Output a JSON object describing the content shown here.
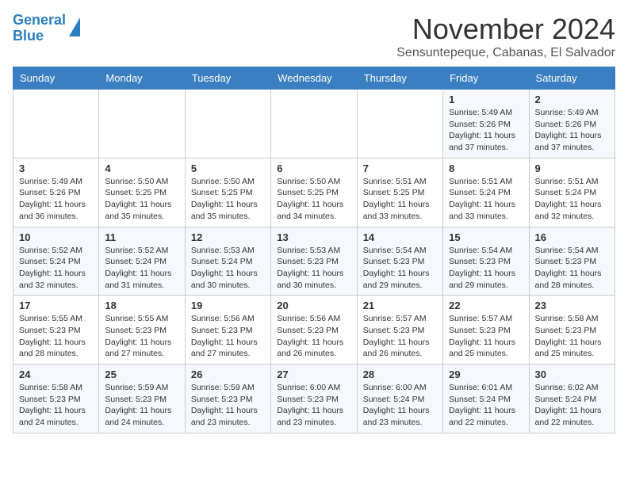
{
  "header": {
    "logo_line1": "General",
    "logo_line2": "Blue",
    "month": "November 2024",
    "location": "Sensuntepeque, Cabanas, El Salvador"
  },
  "days_of_week": [
    "Sunday",
    "Monday",
    "Tuesday",
    "Wednesday",
    "Thursday",
    "Friday",
    "Saturday"
  ],
  "weeks": [
    [
      {
        "num": "",
        "sunrise": "",
        "sunset": "",
        "daylight": ""
      },
      {
        "num": "",
        "sunrise": "",
        "sunset": "",
        "daylight": ""
      },
      {
        "num": "",
        "sunrise": "",
        "sunset": "",
        "daylight": ""
      },
      {
        "num": "",
        "sunrise": "",
        "sunset": "",
        "daylight": ""
      },
      {
        "num": "",
        "sunrise": "",
        "sunset": "",
        "daylight": ""
      },
      {
        "num": "1",
        "sunrise": "Sunrise: 5:49 AM",
        "sunset": "Sunset: 5:26 PM",
        "daylight": "Daylight: 11 hours and 37 minutes."
      },
      {
        "num": "2",
        "sunrise": "Sunrise: 5:49 AM",
        "sunset": "Sunset: 5:26 PM",
        "daylight": "Daylight: 11 hours and 37 minutes."
      }
    ],
    [
      {
        "num": "3",
        "sunrise": "Sunrise: 5:49 AM",
        "sunset": "Sunset: 5:26 PM",
        "daylight": "Daylight: 11 hours and 36 minutes."
      },
      {
        "num": "4",
        "sunrise": "Sunrise: 5:50 AM",
        "sunset": "Sunset: 5:25 PM",
        "daylight": "Daylight: 11 hours and 35 minutes."
      },
      {
        "num": "5",
        "sunrise": "Sunrise: 5:50 AM",
        "sunset": "Sunset: 5:25 PM",
        "daylight": "Daylight: 11 hours and 35 minutes."
      },
      {
        "num": "6",
        "sunrise": "Sunrise: 5:50 AM",
        "sunset": "Sunset: 5:25 PM",
        "daylight": "Daylight: 11 hours and 34 minutes."
      },
      {
        "num": "7",
        "sunrise": "Sunrise: 5:51 AM",
        "sunset": "Sunset: 5:25 PM",
        "daylight": "Daylight: 11 hours and 33 minutes."
      },
      {
        "num": "8",
        "sunrise": "Sunrise: 5:51 AM",
        "sunset": "Sunset: 5:24 PM",
        "daylight": "Daylight: 11 hours and 33 minutes."
      },
      {
        "num": "9",
        "sunrise": "Sunrise: 5:51 AM",
        "sunset": "Sunset: 5:24 PM",
        "daylight": "Daylight: 11 hours and 32 minutes."
      }
    ],
    [
      {
        "num": "10",
        "sunrise": "Sunrise: 5:52 AM",
        "sunset": "Sunset: 5:24 PM",
        "daylight": "Daylight: 11 hours and 32 minutes."
      },
      {
        "num": "11",
        "sunrise": "Sunrise: 5:52 AM",
        "sunset": "Sunset: 5:24 PM",
        "daylight": "Daylight: 11 hours and 31 minutes."
      },
      {
        "num": "12",
        "sunrise": "Sunrise: 5:53 AM",
        "sunset": "Sunset: 5:24 PM",
        "daylight": "Daylight: 11 hours and 30 minutes."
      },
      {
        "num": "13",
        "sunrise": "Sunrise: 5:53 AM",
        "sunset": "Sunset: 5:23 PM",
        "daylight": "Daylight: 11 hours and 30 minutes."
      },
      {
        "num": "14",
        "sunrise": "Sunrise: 5:54 AM",
        "sunset": "Sunset: 5:23 PM",
        "daylight": "Daylight: 11 hours and 29 minutes."
      },
      {
        "num": "15",
        "sunrise": "Sunrise: 5:54 AM",
        "sunset": "Sunset: 5:23 PM",
        "daylight": "Daylight: 11 hours and 29 minutes."
      },
      {
        "num": "16",
        "sunrise": "Sunrise: 5:54 AM",
        "sunset": "Sunset: 5:23 PM",
        "daylight": "Daylight: 11 hours and 28 minutes."
      }
    ],
    [
      {
        "num": "17",
        "sunrise": "Sunrise: 5:55 AM",
        "sunset": "Sunset: 5:23 PM",
        "daylight": "Daylight: 11 hours and 28 minutes."
      },
      {
        "num": "18",
        "sunrise": "Sunrise: 5:55 AM",
        "sunset": "Sunset: 5:23 PM",
        "daylight": "Daylight: 11 hours and 27 minutes."
      },
      {
        "num": "19",
        "sunrise": "Sunrise: 5:56 AM",
        "sunset": "Sunset: 5:23 PM",
        "daylight": "Daylight: 11 hours and 27 minutes."
      },
      {
        "num": "20",
        "sunrise": "Sunrise: 5:56 AM",
        "sunset": "Sunset: 5:23 PM",
        "daylight": "Daylight: 11 hours and 26 minutes."
      },
      {
        "num": "21",
        "sunrise": "Sunrise: 5:57 AM",
        "sunset": "Sunset: 5:23 PM",
        "daylight": "Daylight: 11 hours and 26 minutes."
      },
      {
        "num": "22",
        "sunrise": "Sunrise: 5:57 AM",
        "sunset": "Sunset: 5:23 PM",
        "daylight": "Daylight: 11 hours and 25 minutes."
      },
      {
        "num": "23",
        "sunrise": "Sunrise: 5:58 AM",
        "sunset": "Sunset: 5:23 PM",
        "daylight": "Daylight: 11 hours and 25 minutes."
      }
    ],
    [
      {
        "num": "24",
        "sunrise": "Sunrise: 5:58 AM",
        "sunset": "Sunset: 5:23 PM",
        "daylight": "Daylight: 11 hours and 24 minutes."
      },
      {
        "num": "25",
        "sunrise": "Sunrise: 5:59 AM",
        "sunset": "Sunset: 5:23 PM",
        "daylight": "Daylight: 11 hours and 24 minutes."
      },
      {
        "num": "26",
        "sunrise": "Sunrise: 5:59 AM",
        "sunset": "Sunset: 5:23 PM",
        "daylight": "Daylight: 11 hours and 23 minutes."
      },
      {
        "num": "27",
        "sunrise": "Sunrise: 6:00 AM",
        "sunset": "Sunset: 5:23 PM",
        "daylight": "Daylight: 11 hours and 23 minutes."
      },
      {
        "num": "28",
        "sunrise": "Sunrise: 6:00 AM",
        "sunset": "Sunset: 5:24 PM",
        "daylight": "Daylight: 11 hours and 23 minutes."
      },
      {
        "num": "29",
        "sunrise": "Sunrise: 6:01 AM",
        "sunset": "Sunset: 5:24 PM",
        "daylight": "Daylight: 11 hours and 22 minutes."
      },
      {
        "num": "30",
        "sunrise": "Sunrise: 6:02 AM",
        "sunset": "Sunset: 5:24 PM",
        "daylight": "Daylight: 11 hours and 22 minutes."
      }
    ]
  ]
}
